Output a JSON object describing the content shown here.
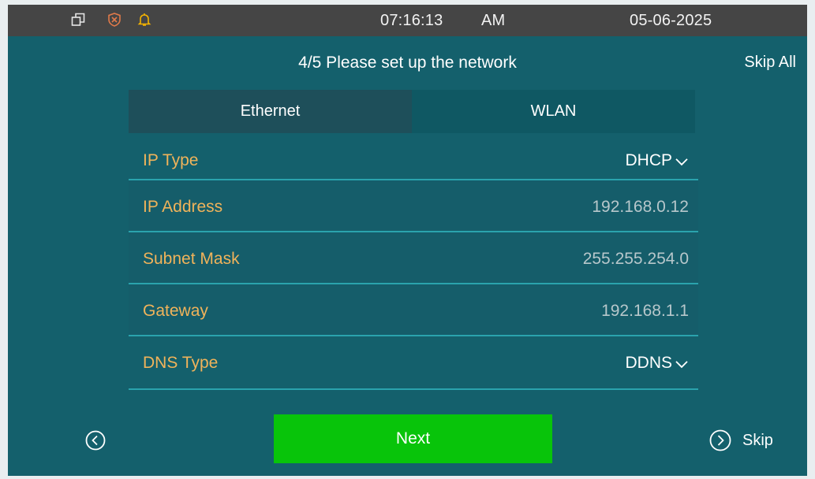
{
  "status_bar": {
    "icons": [
      "multi-window-icon",
      "shield-icon",
      "bell-icon"
    ],
    "time": "07:16:13",
    "meridiem": "AM",
    "date": "05-06-2025"
  },
  "header": {
    "title": "4/5 Please set up the network",
    "skip_all": "Skip All"
  },
  "tabs": [
    {
      "label": "Ethernet",
      "active": true
    },
    {
      "label": "WLAN",
      "active": false
    }
  ],
  "fields": {
    "ip_type": {
      "label": "IP Type",
      "value": "DHCP"
    },
    "ip_address": {
      "label": "IP Address",
      "value": "192.168.0.12"
    },
    "subnet_mask": {
      "label": "Subnet Mask",
      "value": "255.255.254.0"
    },
    "gateway": {
      "label": "Gateway",
      "value": "192.168.1.1"
    },
    "dns_type": {
      "label": "DNS Type",
      "value": "DDNS"
    }
  },
  "footer": {
    "next_label": "Next",
    "skip_label": "Skip",
    "back_icon": "circle-chevron-left-icon",
    "skip_icon": "circle-chevron-right-icon"
  },
  "colors": {
    "background": "#14606c",
    "status_bar": "#454545",
    "field_label": "#f0b35a",
    "next_button": "#08c40a",
    "bell_icon": "#f5b400",
    "shield_icon": "#e07a4a"
  }
}
